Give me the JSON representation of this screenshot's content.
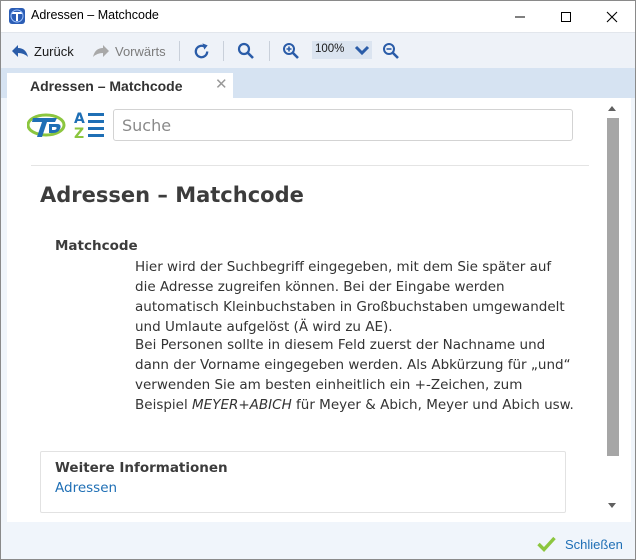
{
  "window": {
    "title": "Adressen – Matchcode"
  },
  "toolbar": {
    "back_label": "Zurück",
    "forward_label": "Vorwärts",
    "zoom_value": "100%"
  },
  "tab": {
    "label": "Adressen – Matchcode",
    "close_glyph": "✕"
  },
  "search": {
    "placeholder": "Suche",
    "value": ""
  },
  "logo": {
    "az_letters": [
      "A",
      "Z"
    ]
  },
  "article": {
    "title": "Adressen – Matchcode",
    "field_name": "Matchcode",
    "paragraph1": "Hier wird der Suchbegriff eingegeben, mit dem Sie später auf die Adresse zugreifen können. Bei der Eingabe werden automatisch Kleinbuchstaben in Großbuchstaben umgewandelt und Umlaute aufgelöst (Ä wird zu AE).",
    "paragraph2_before": "Bei Personen sollte in diesem Feld zuerst der Nachname und dann der Vorname eingegeben werden. Als Abkürzung für „und“ verwenden Sie am besten einheitlich ein +-Zeichen, zum Beispiel ",
    "paragraph2_example": "MEYER+ABICH",
    "paragraph2_after": " für Meyer & Abich, Meyer und Abich usw."
  },
  "more_info": {
    "title": "Weitere Informationen",
    "link_label": "Adressen"
  },
  "footer": {
    "close_label": "Schließen"
  },
  "colors": {
    "accent": "#1f6fb5",
    "check_green": "#8cc63f",
    "tab_strip": "#d6e3f2"
  },
  "icons": [
    "app-icon",
    "minimize-icon",
    "maximize-icon",
    "close-icon",
    "back-arrow-icon",
    "forward-arrow-icon",
    "refresh-icon",
    "search-icon",
    "zoom-in-icon",
    "chevron-down-icon",
    "zoom-out-icon",
    "logo-icon",
    "az-sort-icon",
    "checkmark-icon"
  ]
}
